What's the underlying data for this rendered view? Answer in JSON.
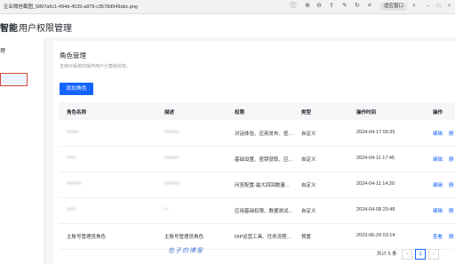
{
  "titlebar": {
    "filename": "企业微信截图_5897a6c1-494d-4539-a878-c3578d949abc.png",
    "zoom_fit_label": "适应窗口"
  },
  "app": {
    "brand": "智能",
    "title": "用户权限管理"
  },
  "sidebar": {
    "item1": "理",
    "item2": ""
  },
  "page": {
    "title": "角色管理",
    "description": "支持对系统的操作用户分角色授权。",
    "add_button": "添加角色"
  },
  "table": {
    "headers": [
      "角色名称",
      "描述",
      "权限",
      "类型",
      "操作时间",
      "操作"
    ],
    "rows": [
      {
        "name": "━━━━",
        "desc": "━━━━━",
        "perm": "对话体验、应用发布、密...",
        "type": "自定义",
        "time": "2024-04-17 09:35",
        "edit": "编辑",
        "more": "删"
      },
      {
        "name": "━━━",
        "desc": "━━━━━",
        "perm": "基础设置、密钥获取、应...",
        "type": "自定义",
        "time": "2024-04-11 17:45",
        "edit": "编辑",
        "more": "删"
      },
      {
        "name": "━━━━━",
        "desc": "━━━━━",
        "perm": "问答配置-最大回回数量...",
        "type": "自定义",
        "time": "2024-04-11 14:20",
        "edit": "编辑",
        "more": "删"
      },
      {
        "name": "━━━",
        "desc": "━",
        "perm": "应用基础权限、数据测试...",
        "type": "自定义",
        "time": "2024-04-08 20:48",
        "edit": "编辑",
        "more": "删"
      },
      {
        "name": "主账号管理员角色",
        "desc": "主账号管理员角色",
        "perm": "DIP运营工具、任务流程...",
        "type": "预置",
        "time": "2023-06-29 03:14",
        "edit": "查看",
        "more": "删"
      }
    ]
  },
  "pagination": {
    "total": "共计 5 条",
    "prev": "‹",
    "page": "1",
    "next": "›"
  },
  "watermark": "包子的博客"
}
